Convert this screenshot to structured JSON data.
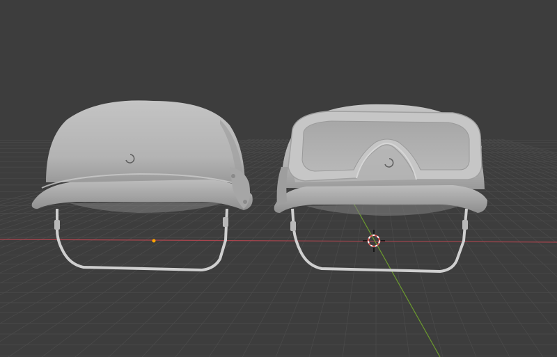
{
  "viewport": {
    "background_color": "#3d3d3d",
    "grid_color": "#4a4a4a",
    "x_axis_color": "#a8454e",
    "y_axis_color": "#6b9a2e"
  },
  "scene": {
    "objects": [
      {
        "name": "helmet",
        "color": "#bdbdbd"
      },
      {
        "name": "helmet-with-goggles",
        "color": "#bdbdbd"
      }
    ],
    "origin_color": "#ffa500",
    "cursor_icon": "3d-cursor-icon"
  }
}
